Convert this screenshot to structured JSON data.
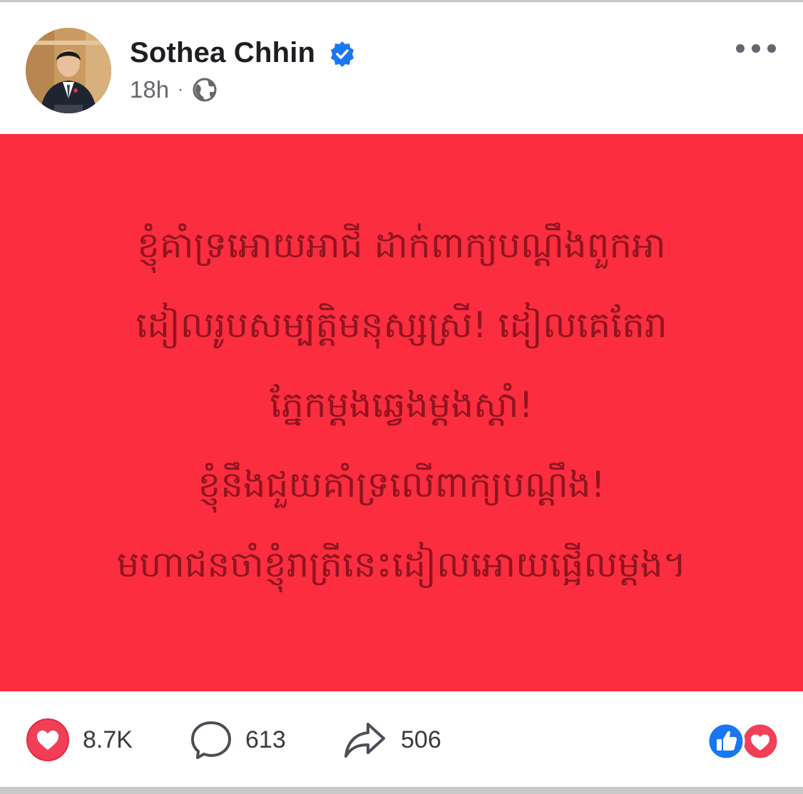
{
  "post": {
    "author_name": "Sothea Chhin",
    "time": "18h",
    "separator": "·",
    "privacy_icon": "globe-icon",
    "verified_icon": "verified-badge-icon",
    "more_icon": "more-options-icon",
    "card_color": "#fb2d3e",
    "text_color": "#8f1520",
    "lines": [
      "ខ្ញុំគាំទ្រអោយអាជី ដាក់ពាក្យបណ្តឹងពួកអា",
      "ដៀលរូបសម្បត្តិមនុស្សស្រី! ដៀលគេតែរា",
      "ភ្នែកម្តងឆ្វេងម្តងស្តាំ!",
      "ខ្ញុំនឹងជួយគាំទ្រលើពាក្យបណ្តឹង!",
      "មហាជនចាំខ្ញុំរាត្រីនេះដៀលអោយផ្អើលម្តង។"
    ]
  },
  "footer": {
    "likes": "8.7K",
    "comments": "613",
    "shares": "506",
    "like_icon": "heart-icon",
    "comment_icon": "comment-bubble-icon",
    "share_icon": "share-arrow-icon",
    "reaction_icons": [
      "thumbs-up-icon",
      "heart-icon"
    ],
    "accent_blue": "#1877f2",
    "accent_red": "#f33e58"
  }
}
